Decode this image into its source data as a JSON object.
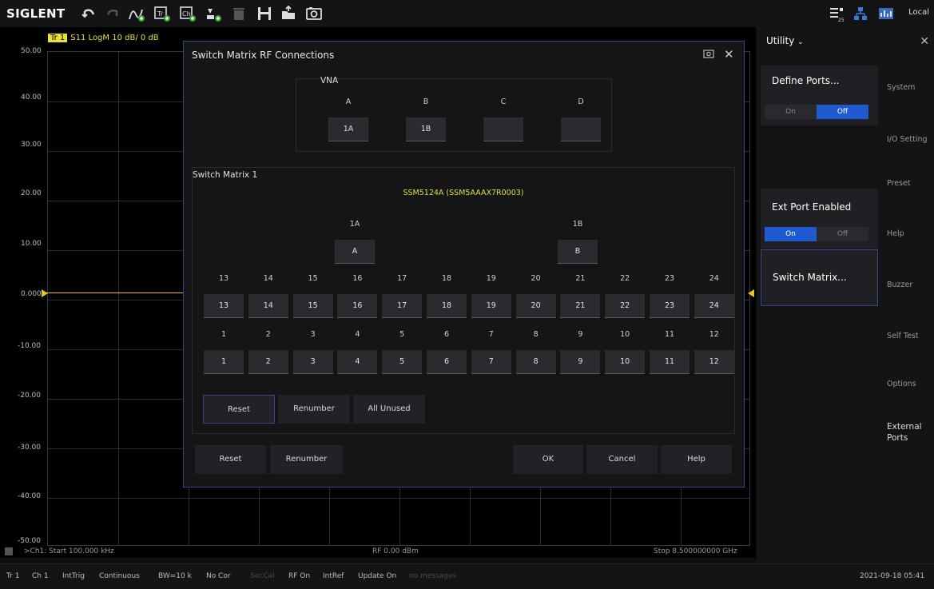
{
  "toolbar": {
    "brand": "SIGLENT",
    "icons": [
      "undo-icon",
      "redo-icon",
      "add-trace-icon",
      "add-trace-window-icon",
      "add-channel-icon",
      "marker-icon",
      "delete-icon",
      "save-icon",
      "open-icon",
      "screenshot-icon"
    ],
    "right_icons": [
      "touch-toggle-icon",
      "network-icon",
      "display-icon"
    ],
    "local_label": "Local"
  },
  "graph": {
    "trace_badge": "Tr 1",
    "trace_info": "S11 LogM 10 dB/ 0 dB",
    "y_ticks": [
      "50.00",
      "40.00",
      "30.00",
      "20.00",
      "10.00",
      "0.000",
      "-10.00",
      "-20.00",
      "-30.00",
      "-40.00",
      "-50.00"
    ],
    "start_label": ">Ch1: Start 100.000 kHz",
    "power_label": "RF 0.00 dBm",
    "stop_label": "Stop 8.500000000 GHz"
  },
  "status": {
    "tr": "Tr 1",
    "ch": "Ch 1",
    "trig": "IntTrig",
    "mode": "Continuous",
    "bw": "BW=10 k",
    "cor": "No Cor",
    "seccal": "SecCal",
    "rf": "RF On",
    "ref": "IntRef",
    "update": "Update On",
    "messages": "no messages",
    "datetime": "2021-09-18 05:41"
  },
  "panel": {
    "title": "Utility",
    "define_ports": {
      "title": "Define Ports...",
      "on": "On",
      "off": "Off",
      "state": "off"
    },
    "ext_port": {
      "title": "Ext Port Enabled",
      "on": "On",
      "off": "Off",
      "state": "on"
    },
    "switch_matrix": "Switch Matrix...",
    "side_items": [
      "System",
      "I/O Setting",
      "Preset",
      "Help",
      "Buzzer",
      "Self Test",
      "Options",
      "External Ports"
    ]
  },
  "dialog": {
    "title": "Switch Matrix RF Connections",
    "vna": {
      "title": "VNA",
      "ports": [
        {
          "label": "A",
          "value": "1A"
        },
        {
          "label": "B",
          "value": "1B"
        },
        {
          "label": "C",
          "value": ""
        },
        {
          "label": "D",
          "value": ""
        }
      ]
    },
    "matrix": {
      "title": "Switch Matrix 1",
      "device": "SSM5124A (SSM5AAAX7R0003)",
      "common": [
        {
          "label": "1A",
          "value": "A"
        },
        {
          "label": "1B",
          "value": "B"
        }
      ],
      "top_row_labels": [
        "13",
        "14",
        "15",
        "16",
        "17",
        "18",
        "19",
        "20",
        "21",
        "22",
        "23",
        "24"
      ],
      "top_row_values": [
        "13",
        "14",
        "15",
        "16",
        "17",
        "18",
        "19",
        "20",
        "21",
        "22",
        "23",
        "24"
      ],
      "bottom_row_labels": [
        "1",
        "2",
        "3",
        "4",
        "5",
        "6",
        "7",
        "8",
        "9",
        "10",
        "11",
        "12"
      ],
      "bottom_row_values": [
        "1",
        "2",
        "3",
        "4",
        "5",
        "6",
        "7",
        "8",
        "9",
        "10",
        "11",
        "12"
      ],
      "reset": "Reset",
      "renumber": "Renumber",
      "all_unused": "All Unused"
    },
    "buttons": {
      "reset": "Reset",
      "renumber": "Renumber",
      "ok": "OK",
      "cancel": "Cancel",
      "help": "Help"
    }
  }
}
